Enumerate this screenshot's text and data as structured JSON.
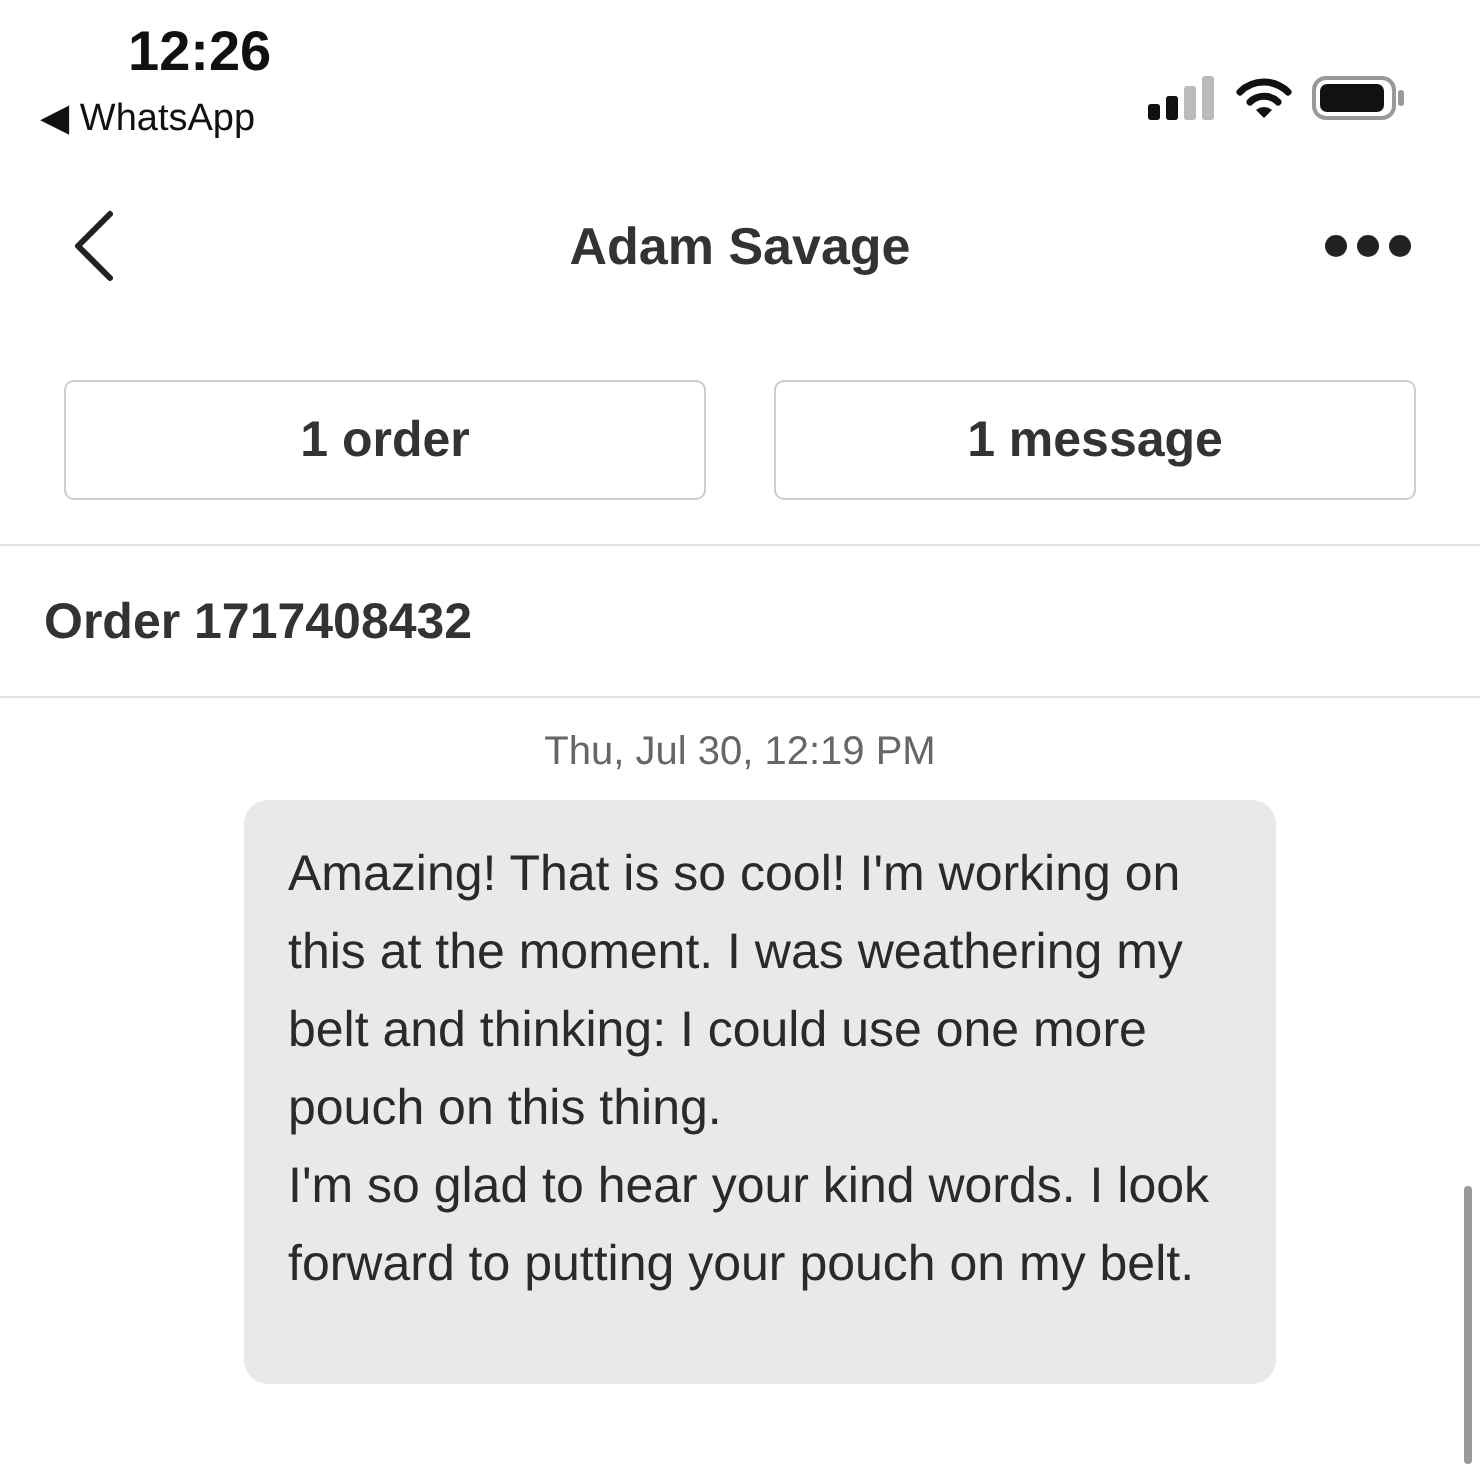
{
  "status_bar": {
    "time": "12:26",
    "back_app": "◀ WhatsApp"
  },
  "header": {
    "title": "Adam Savage"
  },
  "summary_buttons": [
    "1 order",
    "1 message"
  ],
  "order": {
    "title": "Order 1717408432"
  },
  "messages": [
    {
      "timestamp": "Thu, Jul 30, 12:19 PM",
      "text": "Amazing! That is so cool! I'm working on this at the moment. I was weathering my belt and thinking: I could use one more pouch on this thing.\nI'm so glad to hear your kind words. I look forward to putting your pouch on my belt."
    }
  ]
}
